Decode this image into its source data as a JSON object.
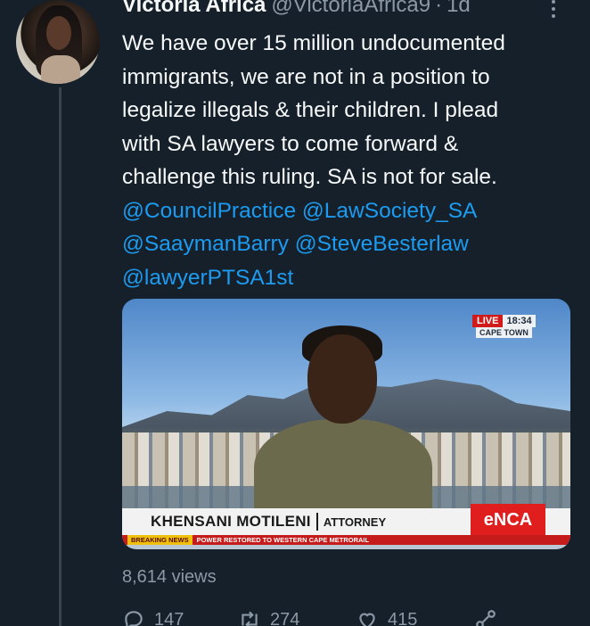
{
  "author": {
    "name": "Victoria Africa",
    "handle": "@VictoriaAfrica9",
    "separator": "·",
    "time": "1d"
  },
  "tweet": {
    "lines": [
      "We have over 15 million undocumented",
      "immigrants, we are not in a position to",
      "legalize illegals & their children. I plead",
      "with SA lawyers to come forward &",
      "challenge this ruling. SA is not for sale."
    ],
    "mentions": [
      "@CouncilPractice",
      "@LawSociety_SA",
      "@SaaymanBarry",
      "@SteveBesterlaw",
      "@lawyerPTSA1st"
    ]
  },
  "media": {
    "live_label": "LIVE",
    "live_time": "18:34",
    "location": "CAPE TOWN",
    "person_name": "KHENSANI MOTILENI",
    "person_title": "ATTORNEY",
    "channel_logo": "eNCA",
    "ticker_tag": "BREAKING NEWS",
    "ticker_text": "POWER RESTORED TO WESTERN CAPE METRORAIL"
  },
  "stats": {
    "views": "8,614 views",
    "replies": "147",
    "retweets": "274",
    "likes": "415"
  },
  "icons": {
    "reply": "reply-icon",
    "retweet": "retweet-icon",
    "like": "heart-icon",
    "share": "share-icon",
    "more": "more-icon"
  },
  "colors": {
    "background": "#15202b",
    "text": "#f7f9f9",
    "muted": "#8b98a5",
    "mention": "#1d9bf0"
  }
}
